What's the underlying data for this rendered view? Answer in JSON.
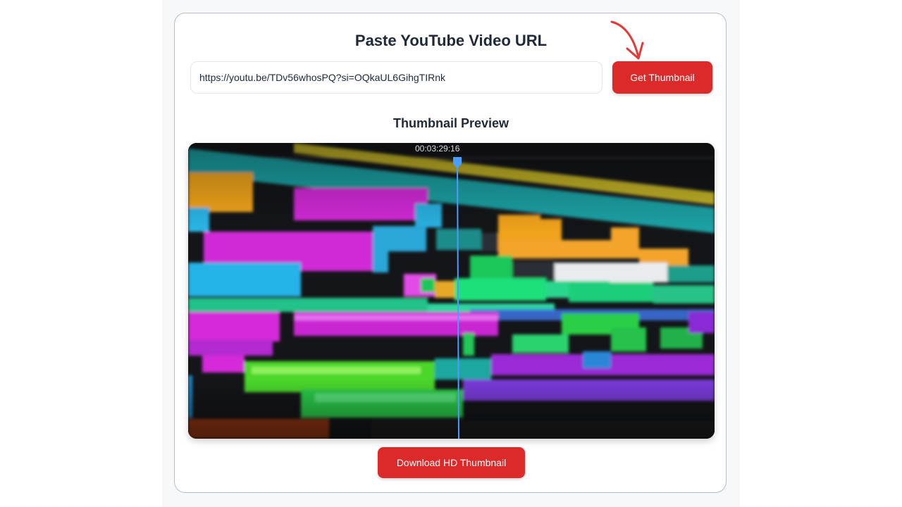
{
  "header": {
    "title": "Paste YouTube Video URL"
  },
  "url_input": {
    "value": "https://youtu.be/TDv56whosPQ?si=OQkaUL6GihgTIRnk"
  },
  "buttons": {
    "get_thumbnail": "Get Thumbnail",
    "download_hd": "Download HD Thumbnail"
  },
  "preview": {
    "heading": "Thumbnail Preview",
    "timecode": "00:03:29:16",
    "image_subject": "blurred video editing timeline"
  },
  "colors": {
    "accent": "#dc2a2a",
    "arrow": "#e53935",
    "border": "#b9bdc4",
    "text": "#1f2937"
  },
  "icons": {
    "arrow": "hand-drawn-arrow-icon"
  }
}
